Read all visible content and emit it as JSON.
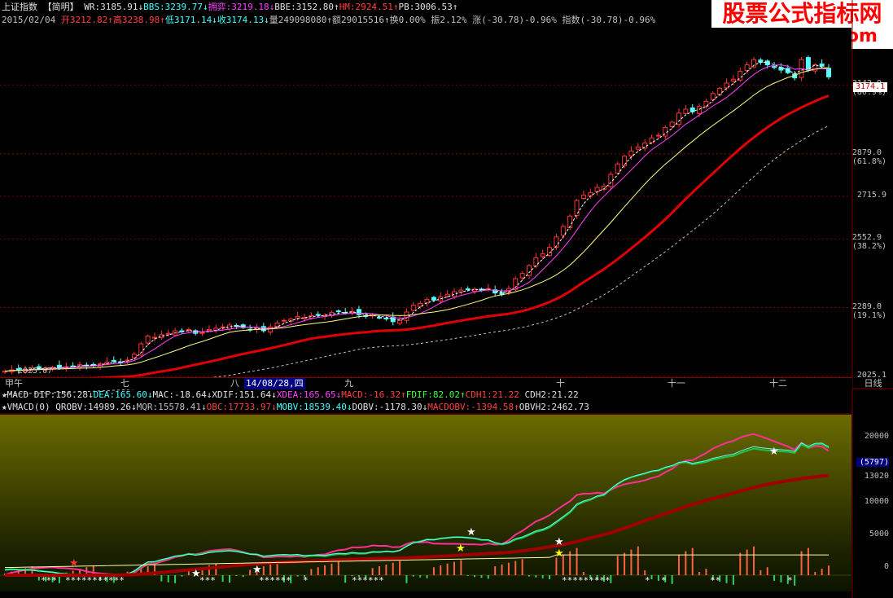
{
  "header": {
    "row1": [
      {
        "text": "上证指数",
        "cls": "c-w"
      },
      {
        "text": " 【简明】",
        "cls": "c-w"
      },
      {
        "text": " WR:3185.91↓",
        "cls": "c-w"
      },
      {
        "text": "BBS:3239.77↓",
        "cls": "c-c"
      },
      {
        "text": "拥弈:3219.18↓",
        "cls": "c-m"
      },
      {
        "text": "BBE:3152.80↑",
        "cls": "c-w"
      },
      {
        "text": "HM:2924.51↑",
        "cls": "c-r"
      },
      {
        "text": "PB:3006.53↑",
        "cls": "c-w"
      }
    ],
    "row2": [
      {
        "text": "2015/02/04 ",
        "cls": "c-gray"
      },
      {
        "text": "开3212.82↑",
        "cls": "c-r"
      },
      {
        "text": "高3238.98↑",
        "cls": "c-r"
      },
      {
        "text": "低3171.14↓",
        "cls": "c-c"
      },
      {
        "text": "收3174.13↓",
        "cls": "c-c"
      },
      {
        "text": "量249098080↑",
        "cls": "c-gray"
      },
      {
        "text": "额29015516↑",
        "cls": "c-gray"
      },
      {
        "text": "换0.00% ",
        "cls": "c-gray"
      },
      {
        "text": "振2.12% ",
        "cls": "c-gray"
      },
      {
        "text": "涨(-30.78)-0.96% ",
        "cls": "c-gray"
      },
      {
        "text": "指数(-30.78)-0.96%",
        "cls": "c-gray"
      }
    ]
  },
  "watermark": {
    "title": "股票公式指标网",
    "url": "www.gszb.com"
  },
  "price_axis": {
    "current": "3174.1",
    "labels": [
      {
        "v": "3142.9",
        "p": "(80.9%)"
      },
      {
        "v": "2879.0",
        "p": "(61.8%)"
      },
      {
        "v": "2715.9",
        "p": ""
      },
      {
        "v": "2552.9",
        "p": "(38.2%)"
      },
      {
        "v": "2289.0",
        "p": "(19.1%)"
      },
      {
        "v": "2025.1",
        "p": ""
      }
    ],
    "low_label": "2025.07"
  },
  "time_axis": {
    "labels": [
      "甲午",
      "七",
      "八",
      "九",
      "十",
      "十一",
      "十二"
    ],
    "date_tag": "14/08/28,四",
    "period_button": "日线"
  },
  "indicator": {
    "row1": [
      {
        "text": "★MACD ",
        "cls": "c-w"
      },
      {
        "text": "DIF:156.28↓",
        "cls": "c-w"
      },
      {
        "text": "DEA:165.60↓",
        "cls": "c-c"
      },
      {
        "text": "MAC:-18.64↓",
        "cls": "c-w"
      },
      {
        "text": "XDIF:151.64↓",
        "cls": "c-w"
      },
      {
        "text": "XDEA:165.65↓",
        "cls": "c-m"
      },
      {
        "text": "MACD:-16.32↑",
        "cls": "c-r"
      },
      {
        "text": "FDIF:82.02↑",
        "cls": "c-g"
      },
      {
        "text": "CDH1:21.22 ",
        "cls": "c-r"
      },
      {
        "text": "CDH2:21.22",
        "cls": "c-w"
      }
    ],
    "row2": [
      {
        "text": "★VMACD(0) ",
        "cls": "c-w"
      },
      {
        "text": "QROBV:14989.26↓",
        "cls": "c-w"
      },
      {
        "text": "MQR:15578.41↓",
        "cls": "c-gray"
      },
      {
        "text": "OBC:17733.97↓",
        "cls": "c-r"
      },
      {
        "text": "MOBV:18539.40↓",
        "cls": "c-c"
      },
      {
        "text": "DOBV:-1178.30↓",
        "cls": "c-w"
      },
      {
        "text": "MACDOBV:-1394.58↑",
        "cls": "c-r"
      },
      {
        "text": "OBVH2:2462.73",
        "cls": "c-w"
      }
    ],
    "axis": [
      "20000",
      "(5797)",
      "13020",
      "10000",
      "5000",
      "0"
    ]
  },
  "chart_data": {
    "type": "candlestick",
    "title": "上证指数",
    "ylim": [
      2025.1,
      3300
    ],
    "closes": [
      2045,
      2050,
      2049,
      2052,
      2056,
      2055,
      2057,
      2060,
      2058,
      2062,
      2065,
      2070,
      2066,
      2068,
      2074,
      2080,
      2085,
      2079,
      2088,
      2110,
      2150,
      2180,
      2175,
      2185,
      2190,
      2200,
      2198,
      2205,
      2190,
      2193,
      2205,
      2210,
      2215,
      2222,
      2218,
      2212,
      2205,
      2210,
      2200,
      2215,
      2230,
      2240,
      2245,
      2255,
      2250,
      2258,
      2262,
      2258,
      2270,
      2275,
      2268,
      2274,
      2262,
      2255,
      2260,
      2250,
      2248,
      2235,
      2240,
      2272,
      2298,
      2305,
      2320,
      2318,
      2330,
      2340,
      2350,
      2356,
      2358,
      2360,
      2355,
      2362,
      2345,
      2340,
      2362,
      2400,
      2420,
      2450,
      2480,
      2495,
      2520,
      2560,
      2600,
      2640,
      2700,
      2720,
      2730,
      2750,
      2755,
      2800,
      2840,
      2870,
      2890,
      2905,
      2920,
      2940,
      2950,
      2980,
      3000,
      3035,
      3050,
      3040,
      3060,
      3080,
      3110,
      3130,
      3150,
      3165,
      3195,
      3220,
      3240,
      3230,
      3220,
      3210,
      3200,
      3190,
      3170,
      3240,
      3200,
      3220,
      3215,
      3174
    ]
  }
}
